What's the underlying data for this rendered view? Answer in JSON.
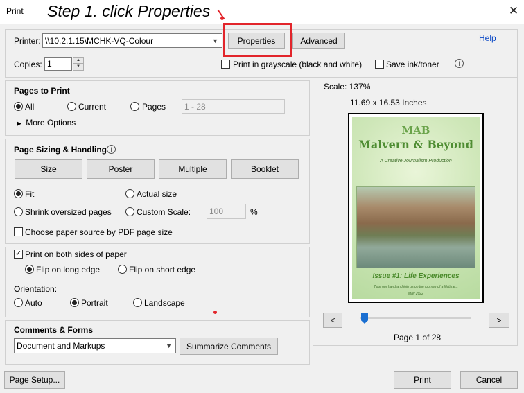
{
  "window": {
    "title": "Print",
    "close": "✕"
  },
  "annotation": {
    "text": "Step 1. click Properties"
  },
  "printer": {
    "label": "Printer:",
    "value": "\\\\10.2.1.15\\MCHK-VQ-Colour",
    "properties_label": "Properties",
    "advanced_label": "Advanced",
    "help_label": "Help"
  },
  "copies": {
    "label": "Copies:",
    "value": "1"
  },
  "options": {
    "grayscale_label": "Print in grayscale (black and white)",
    "save_ink_label": "Save ink/toner"
  },
  "pages_to_print": {
    "heading": "Pages to Print",
    "all_label": "All",
    "current_label": "Current",
    "pages_label": "Pages",
    "pages_placeholder": "1 - 28",
    "more_options_label": "More Options"
  },
  "sizing": {
    "heading": "Page Sizing & Handling",
    "size_label": "Size",
    "poster_label": "Poster",
    "multiple_label": "Multiple",
    "booklet_label": "Booklet",
    "fit_label": "Fit",
    "actual_label": "Actual size",
    "shrink_label": "Shrink oversized pages",
    "custom_label": "Custom Scale:",
    "custom_value": "100",
    "percent": "%",
    "choose_source_label": "Choose paper source by PDF page size"
  },
  "duplex": {
    "both_sides_label": "Print on both sides of paper",
    "long_edge_label": "Flip on long edge",
    "short_edge_label": "Flip on short edge"
  },
  "orientation": {
    "label": "Orientation:",
    "auto_label": "Auto",
    "portrait_label": "Portrait",
    "landscape_label": "Landscape"
  },
  "comments": {
    "heading": "Comments & Forms",
    "value": "Document and Markups",
    "summarize_label": "Summarize Comments"
  },
  "preview": {
    "scale": "Scale: 137%",
    "dimensions": "11.69 x 16.53 Inches",
    "page_indicator": "Page 1 of 28",
    "prev": "<",
    "next": ">",
    "title1": "MAB",
    "title2": "Malvern & Beyond",
    "subtitle": "A Creative Journalism Production",
    "issue": "Issue #1: Life Experiences",
    "tagline": "Take our hand and join us on the journey of a lifetime...",
    "date": "May 2022"
  },
  "footer": {
    "page_setup_label": "Page Setup...",
    "print_label": "Print",
    "cancel_label": "Cancel"
  }
}
